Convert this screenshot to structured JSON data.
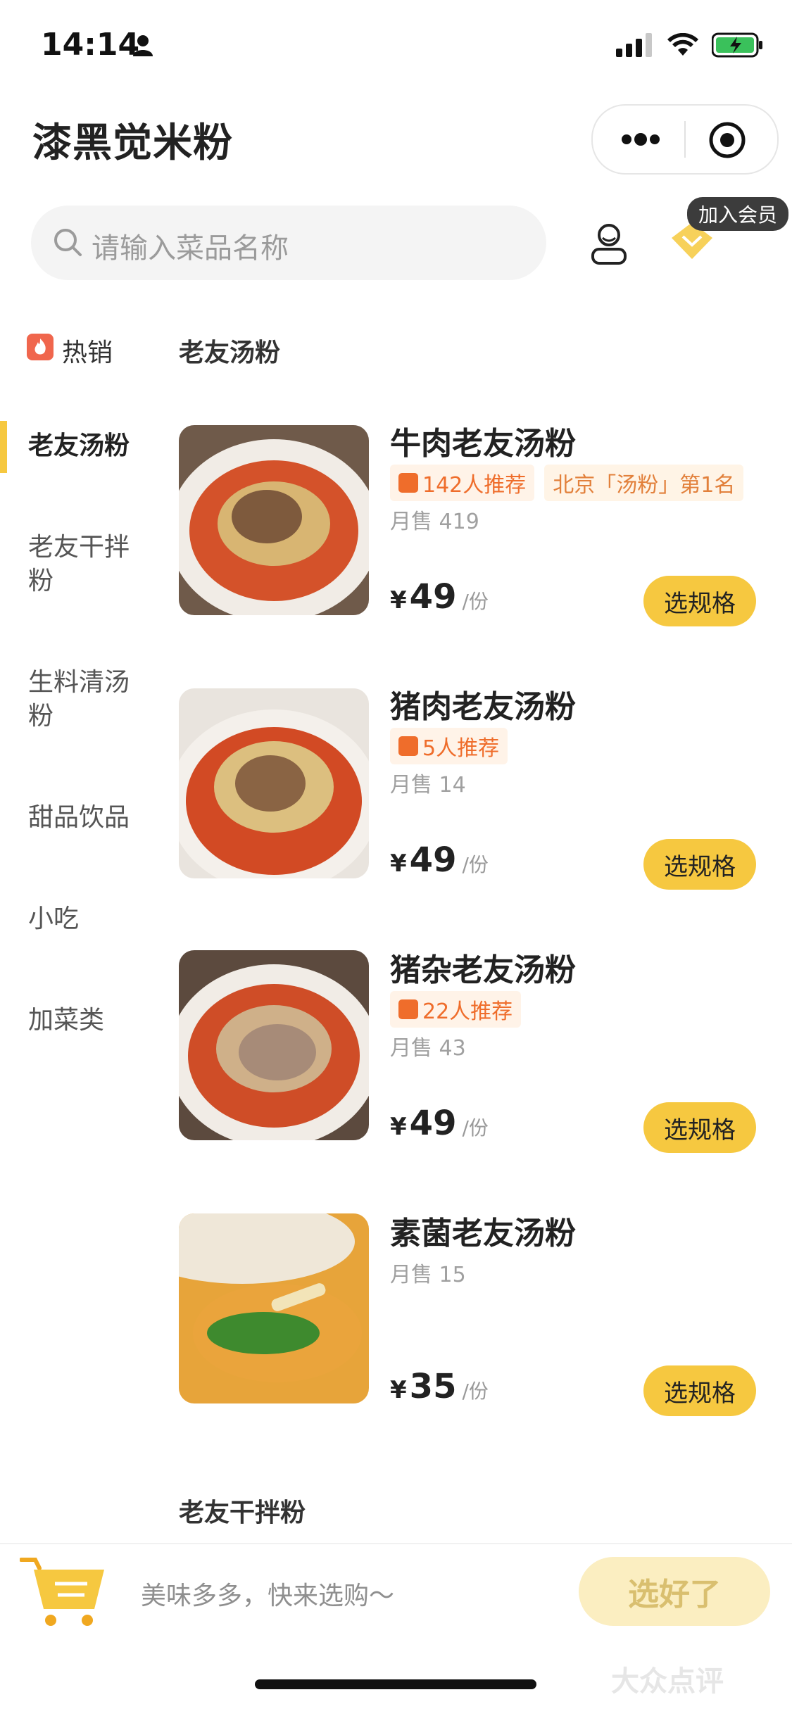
{
  "status_bar": {
    "time": "14:14"
  },
  "header": {
    "title": "漆黑觉米粉"
  },
  "search": {
    "placeholder": "请输入菜品名称"
  },
  "member": {
    "tag": "加入会员"
  },
  "sidebar": {
    "hot_label": "热销",
    "items": [
      {
        "label": "老友汤粉",
        "active": true
      },
      {
        "label": "老友干拌粉",
        "active": false
      },
      {
        "label": "生料清汤粉",
        "active": false
      },
      {
        "label": "甜品饮品",
        "active": false
      },
      {
        "label": "小吃",
        "active": false
      },
      {
        "label": "加菜类",
        "active": false
      }
    ]
  },
  "section": {
    "current": "老友汤粉",
    "next": "老友干拌粉"
  },
  "items": [
    {
      "name": "牛肉老友汤粉",
      "rec": "142人推荐",
      "rank": "北京「汤粉」第1名",
      "sales": "月售 419",
      "currency": "¥",
      "price": "49",
      "unit": "/份",
      "button": "选规格"
    },
    {
      "name": "猪肉老友汤粉",
      "rec": "5人推荐",
      "sales": "月售 14",
      "currency": "¥",
      "price": "49",
      "unit": "/份",
      "button": "选规格"
    },
    {
      "name": "猪杂老友汤粉",
      "rec": "22人推荐",
      "sales": "月售 43",
      "currency": "¥",
      "price": "49",
      "unit": "/份",
      "button": "选规格"
    },
    {
      "name": "素菌老友汤粉",
      "sales": "月售 15",
      "currency": "¥",
      "price": "35",
      "unit": "/份",
      "button": "选规格"
    }
  ],
  "bottom_bar": {
    "cart_text": "美味多多，快来选购～",
    "done_button": "选好了"
  },
  "watermark": "大众点评",
  "colors": {
    "accent": "#f6c840",
    "tag_orange": "#ef6d2b",
    "hot_red": "#f0664d"
  }
}
